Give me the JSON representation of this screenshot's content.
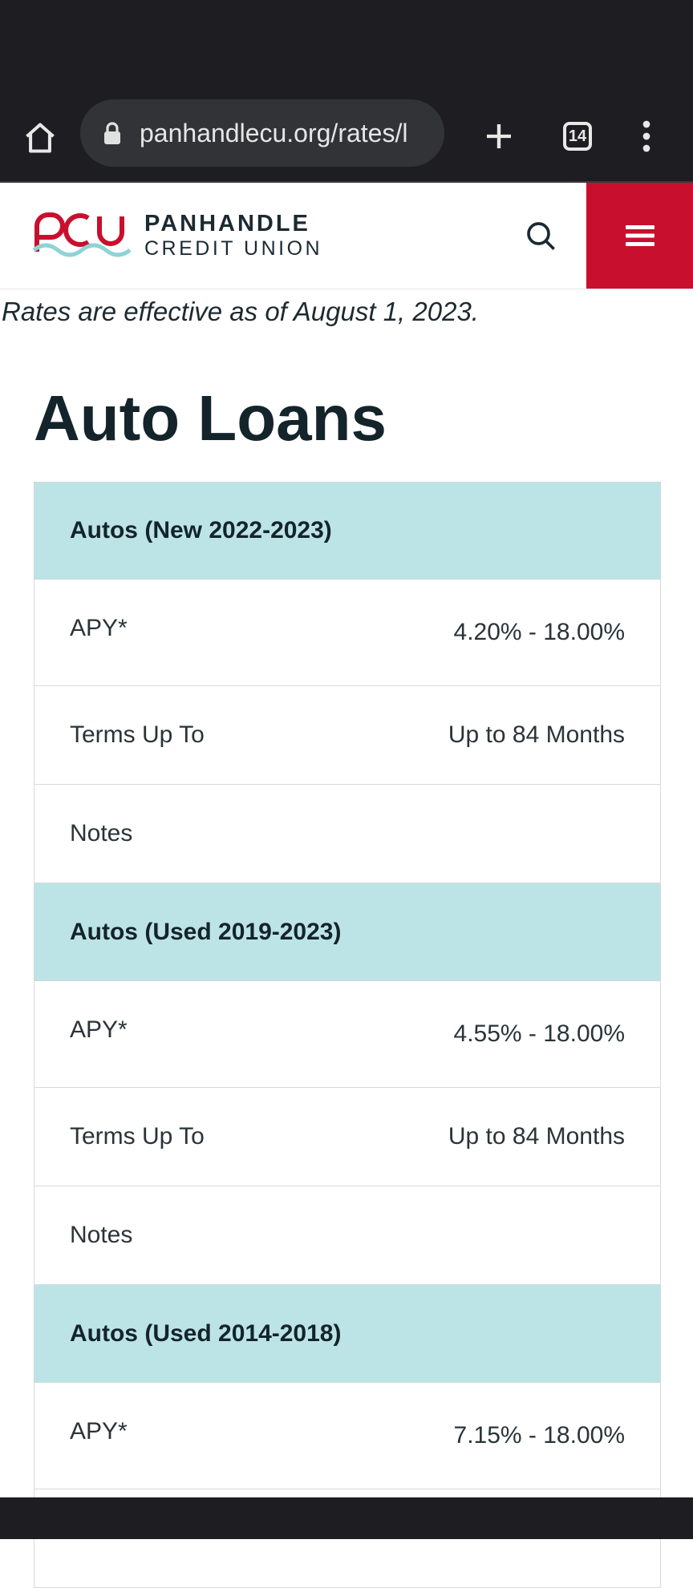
{
  "browser": {
    "url": "panhandlecu.org/rates/l",
    "tab_count": "14"
  },
  "site": {
    "logo_line1": "PANHANDLE",
    "logo_line2": "CREDIT UNION"
  },
  "colors": {
    "brand_red": "#c8102e",
    "header_teal": "#bce4e6",
    "logo_teal": "#8fd3d6"
  },
  "page": {
    "effective_note": "Rates are effective as of August 1, 2023.",
    "title": "Auto Loans"
  },
  "rates": {
    "sections": [
      {
        "heading": "Autos (New 2022-2023)",
        "apy_label": "APY*",
        "apy_value": "4.20% - 18.00%",
        "terms_label": "Terms Up To",
        "terms_value": "Up to 84 Months",
        "notes_label": "Notes"
      },
      {
        "heading": "Autos (Used 2019-2023)",
        "apy_label": "APY*",
        "apy_value": "4.55% - 18.00%",
        "terms_label": "Terms Up To",
        "terms_value": "Up to 84 Months",
        "notes_label": "Notes"
      },
      {
        "heading": "Autos (Used 2014-2018)",
        "apy_label": "APY*",
        "apy_value": "7.15% - 18.00%"
      }
    ]
  }
}
